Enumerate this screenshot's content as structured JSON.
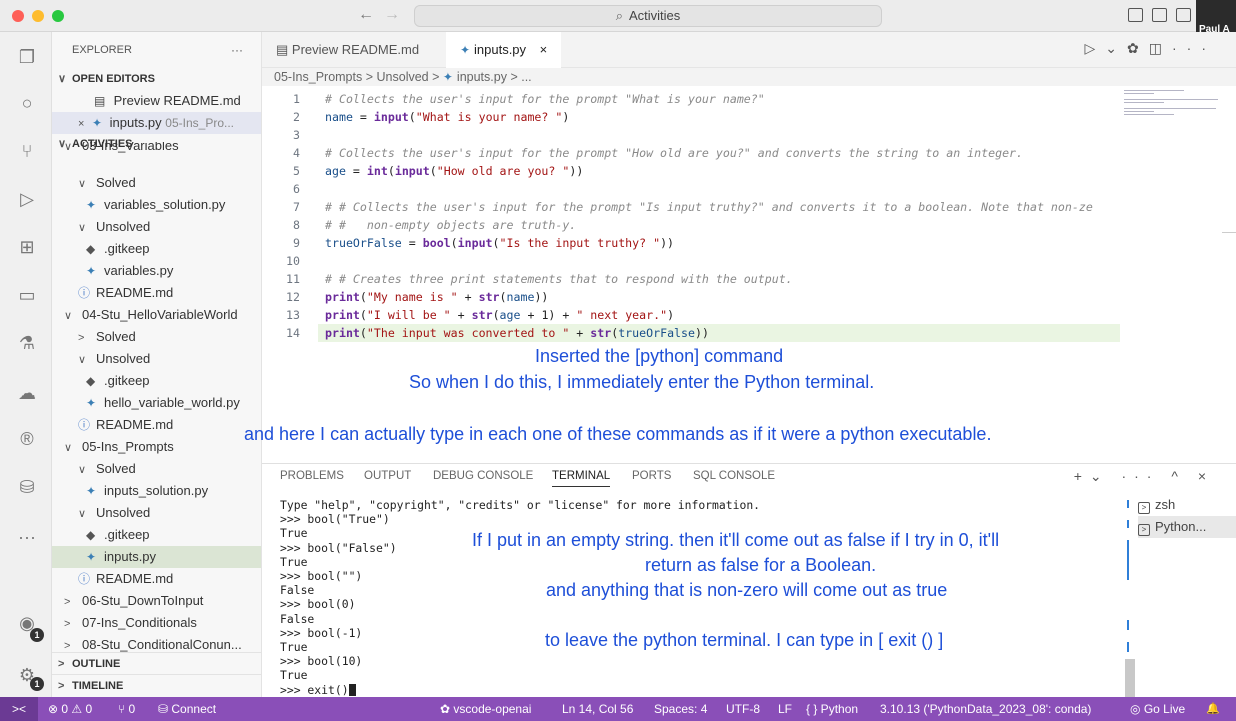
{
  "titlebar": {
    "back_arrow": "←",
    "forward_arrow": "→",
    "search_label": "Activities",
    "user_name": "Paul A"
  },
  "sidebar": {
    "title": "EXPLORER",
    "more": "···",
    "open_editors_label": "OPEN EDITORS",
    "open_editors": [
      {
        "label": "Preview README.md",
        "detail": ""
      },
      {
        "label": "inputs.py",
        "detail": "05-Ins_Pro..."
      }
    ],
    "activities_label": "ACTIVITIES",
    "tree": [
      {
        "label": "03-Ins_Variables",
        "kind": "folder",
        "indent": 1
      },
      {
        "label": "Solved",
        "kind": "folder-open",
        "indent": 2
      },
      {
        "label": "variables_solution.py",
        "kind": "py",
        "indent": 3
      },
      {
        "label": "Unsolved",
        "kind": "folder-open",
        "indent": 2
      },
      {
        "label": ".gitkeep",
        "kind": "git",
        "indent": 3
      },
      {
        "label": "variables.py",
        "kind": "py",
        "indent": 3
      },
      {
        "label": "README.md",
        "kind": "info",
        "indent": 2
      },
      {
        "label": "04-Stu_HelloVariableWorld",
        "kind": "folder-open",
        "indent": 1
      },
      {
        "label": "Solved",
        "kind": "folder-closed",
        "indent": 2
      },
      {
        "label": "Unsolved",
        "kind": "folder-open",
        "indent": 2
      },
      {
        "label": ".gitkeep",
        "kind": "git",
        "indent": 3
      },
      {
        "label": "hello_variable_world.py",
        "kind": "py",
        "indent": 3
      },
      {
        "label": "README.md",
        "kind": "info",
        "indent": 2
      },
      {
        "label": "05-Ins_Prompts",
        "kind": "folder-open",
        "indent": 1
      },
      {
        "label": "Solved",
        "kind": "folder-open",
        "indent": 2
      },
      {
        "label": "inputs_solution.py",
        "kind": "py",
        "indent": 3
      },
      {
        "label": "Unsolved",
        "kind": "folder-open",
        "indent": 2
      },
      {
        "label": ".gitkeep",
        "kind": "git",
        "indent": 3
      },
      {
        "label": "inputs.py",
        "kind": "py",
        "indent": 3
      },
      {
        "label": "README.md",
        "kind": "info",
        "indent": 2
      },
      {
        "label": "06-Stu_DownToInput",
        "kind": "folder-closed",
        "indent": 1
      },
      {
        "label": "07-Ins_Conditionals",
        "kind": "folder-closed",
        "indent": 1
      },
      {
        "label": "08-Stu_ConditionalConun...",
        "kind": "folder-closed",
        "indent": 1
      }
    ],
    "outline_label": "OUTLINE",
    "timeline_label": "TIMELINE"
  },
  "tabs": [
    {
      "label": "Preview README.md",
      "active": false
    },
    {
      "label": "inputs.py",
      "active": true,
      "close": "×"
    }
  ],
  "breadcrumb": {
    "parts": [
      "05-Ins_Prompts",
      "Unsolved",
      "inputs.py",
      "..."
    ],
    "sep": ">"
  },
  "editor": {
    "lines": [
      {
        "n": "1",
        "tokens": [
          [
            "c-comment",
            "# Collects the user's input for the prompt \"What is your name?\""
          ]
        ]
      },
      {
        "n": "2",
        "tokens": [
          [
            "c-var",
            "name"
          ],
          [
            "c-plain",
            " = "
          ],
          [
            "c-fn",
            "input"
          ],
          [
            "c-plain",
            "("
          ],
          [
            "c-str",
            "\"What is your name? \""
          ],
          [
            "c-plain",
            ")"
          ]
        ]
      },
      {
        "n": "3",
        "tokens": []
      },
      {
        "n": "4",
        "tokens": [
          [
            "c-comment",
            "# Collects the user's input for the prompt \"How old are you?\" and converts the string to an integer."
          ]
        ]
      },
      {
        "n": "5",
        "tokens": [
          [
            "c-var",
            "age"
          ],
          [
            "c-plain",
            " = "
          ],
          [
            "c-fn",
            "int"
          ],
          [
            "c-plain",
            "("
          ],
          [
            "c-fn",
            "input"
          ],
          [
            "c-plain",
            "("
          ],
          [
            "c-str",
            "\"How old are you? \""
          ],
          [
            "c-plain",
            "))"
          ]
        ]
      },
      {
        "n": "6",
        "tokens": []
      },
      {
        "n": "7",
        "tokens": [
          [
            "c-comment",
            "# # Collects the user's input for the prompt \"Is input truthy?\" and converts it to a boolean. Note that non-ze"
          ]
        ]
      },
      {
        "n": "8",
        "tokens": [
          [
            "c-comment",
            "# #   non-empty objects are truth-y."
          ]
        ]
      },
      {
        "n": "9",
        "tokens": [
          [
            "c-var",
            "trueOrFalse"
          ],
          [
            "c-plain",
            " = "
          ],
          [
            "c-fn",
            "bool"
          ],
          [
            "c-plain",
            "("
          ],
          [
            "c-fn",
            "input"
          ],
          [
            "c-plain",
            "("
          ],
          [
            "c-str",
            "\"Is the input truthy? \""
          ],
          [
            "c-plain",
            "))"
          ]
        ]
      },
      {
        "n": "10",
        "tokens": []
      },
      {
        "n": "11",
        "tokens": [
          [
            "c-comment",
            "# # Creates three print statements that to respond with the output."
          ]
        ]
      },
      {
        "n": "12",
        "tokens": [
          [
            "c-fn",
            "print"
          ],
          [
            "c-plain",
            "("
          ],
          [
            "c-str",
            "\"My name is \""
          ],
          [
            "c-plain",
            " + "
          ],
          [
            "c-fn",
            "str"
          ],
          [
            "c-plain",
            "("
          ],
          [
            "c-var",
            "name"
          ],
          [
            "c-plain",
            "))"
          ]
        ]
      },
      {
        "n": "13",
        "tokens": [
          [
            "c-fn",
            "print"
          ],
          [
            "c-plain",
            "("
          ],
          [
            "c-str",
            "\"I will be \""
          ],
          [
            "c-plain",
            " + "
          ],
          [
            "c-fn",
            "str"
          ],
          [
            "c-plain",
            "("
          ],
          [
            "c-var",
            "age"
          ],
          [
            "c-plain",
            " + 1) + "
          ],
          [
            "c-str",
            "\" next year.\""
          ],
          [
            "c-plain",
            ")"
          ]
        ]
      },
      {
        "n": "14",
        "tokens": [
          [
            "c-fn",
            "print"
          ],
          [
            "c-plain",
            "("
          ],
          [
            "c-str",
            "\"The input was converted to \""
          ],
          [
            "c-plain",
            " + "
          ],
          [
            "c-fn",
            "str"
          ],
          [
            "c-plain",
            "("
          ],
          [
            "c-var",
            "trueOrFalse"
          ],
          [
            "c-plain",
            "))"
          ]
        ]
      }
    ]
  },
  "captions": {
    "c1": "Inserted the [python] command",
    "c2": "So when I do this, I immediately enter the Python terminal.",
    "c3": "and here I can actually type in each one of these commands as if it were a python executable.",
    "c4a": "If I put in an empty string. then it'll come out as false if I try in 0, it'll",
    "c4b": "return as false for a Boolean.",
    "c5": "and anything that is non-zero will come out as true",
    "c6": "to leave the python terminal. I can type in  [ exit () ]"
  },
  "panel": {
    "tabs": [
      "PROBLEMS",
      "OUTPUT",
      "DEBUG CONSOLE",
      "TERMINAL",
      "PORTS",
      "SQL CONSOLE"
    ],
    "active_tab": "TERMINAL",
    "actions": "+⌄ ··· ^ ×",
    "terminal_lines": [
      "Type \"help\", \"copyright\", \"credits\" or \"license\" for more information.",
      ">>> bool(\"True\")",
      "True",
      ">>> bool(\"False\")",
      "True",
      ">>> bool(\"\")",
      "False",
      ">>> bool(0)",
      "False",
      ">>> bool(-1)",
      "True",
      ">>> bool(10)",
      "True",
      ">>> exit()"
    ],
    "terminals": [
      {
        "label": "zsh",
        "selected": false
      },
      {
        "label": "Python...",
        "selected": true
      }
    ]
  },
  "statusbar": {
    "remote": "><",
    "problems": "⊗ 0 ⚠ 0",
    "ports": "⑂ 0",
    "connect": "Connect",
    "account": "vscode-openai",
    "position": "Ln 14, Col 56",
    "spaces": "Spaces: 4",
    "encoding": "UTF-8",
    "eol": "LF",
    "language": "{ } Python",
    "interpreter": "3.10.13 ('PythonData_2023_08': conda)",
    "golive": "Go Live",
    "bell": "🔔"
  },
  "activity_badges": {
    "accounts": "1",
    "settings": "1"
  },
  "colors": {
    "accent": "#8a4fb8",
    "caption": "#1e4fd8"
  }
}
